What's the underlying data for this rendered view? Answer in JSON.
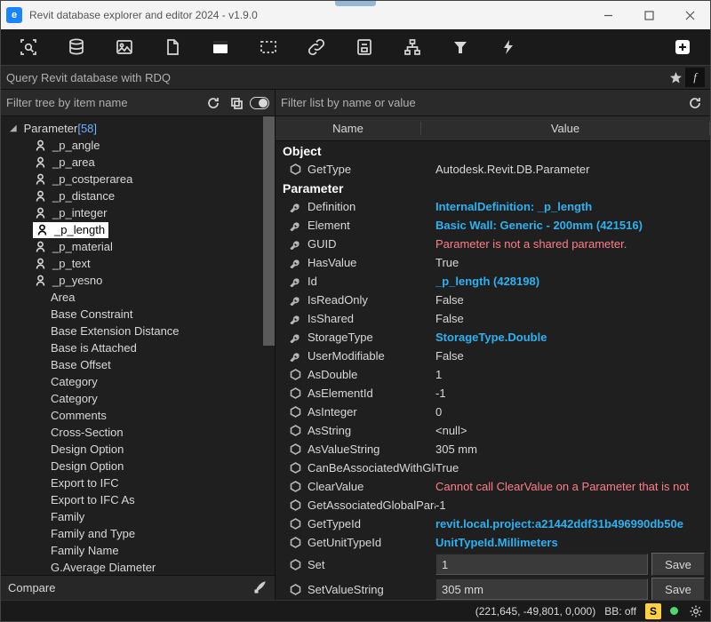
{
  "window": {
    "title": "Revit database explorer and editor 2024 - v1.9.0"
  },
  "search": {
    "placeholder": "Query Revit database with RDQ",
    "fx_label": "f"
  },
  "left_filter": {
    "placeholder": "Filter tree by item name"
  },
  "right_filter": {
    "placeholder": "Filter list by name or value"
  },
  "tree": {
    "root_label": "Parameter",
    "root_count": "[58]",
    "items": [
      {
        "label": "_p_angle"
      },
      {
        "label": "_p_area"
      },
      {
        "label": "_p_costperarea"
      },
      {
        "label": "_p_distance"
      },
      {
        "label": "_p_integer"
      },
      {
        "label": "_p_length",
        "selected": true
      },
      {
        "label": "_p_material"
      },
      {
        "label": "_p_text"
      },
      {
        "label": "_p_yesno"
      }
    ],
    "sub": [
      "Area",
      "Base Constraint",
      "Base Extension Distance",
      "Base is Attached",
      "Base Offset",
      "Category",
      "Category",
      "Comments",
      "Cross-Section",
      "Design Option",
      "Design Option",
      "Export to IFC",
      "Export to IFC As",
      "Family",
      "Family and Type",
      "Family Name",
      "G.Average Diameter"
    ]
  },
  "columns": {
    "name": "Name",
    "value": "Value"
  },
  "sections": [
    {
      "title": "Object",
      "rows": [
        {
          "icon": "hex",
          "name": "GetType",
          "value": "Autodesk.Revit.DB.Parameter"
        }
      ]
    },
    {
      "title": "Parameter",
      "rows": [
        {
          "icon": "wrench",
          "name": "Definition",
          "value": "InternalDefinition: _p_length",
          "cls": "link"
        },
        {
          "icon": "wrench",
          "name": "Element",
          "value": "Basic Wall: Generic - 200mm (421516)",
          "cls": "link"
        },
        {
          "icon": "wrench",
          "name": "GUID",
          "value": "Parameter is not a shared parameter.",
          "cls": "warn"
        },
        {
          "icon": "wrench",
          "name": "HasValue",
          "value": "True"
        },
        {
          "icon": "wrench",
          "name": "Id",
          "value": "_p_length (428198)",
          "cls": "link"
        },
        {
          "icon": "wrench",
          "name": "IsReadOnly",
          "value": "False"
        },
        {
          "icon": "wrench",
          "name": "IsShared",
          "value": "False"
        },
        {
          "icon": "wrench",
          "name": "StorageType",
          "value": "StorageType.Double",
          "cls": "link"
        },
        {
          "icon": "wrench",
          "name": "UserModifiable",
          "value": "False"
        },
        {
          "icon": "hex",
          "name": "AsDouble",
          "value": "1"
        },
        {
          "icon": "hex",
          "name": "AsElementId",
          "value": "-1"
        },
        {
          "icon": "hex",
          "name": "AsInteger",
          "value": "0"
        },
        {
          "icon": "hex",
          "name": "AsString",
          "value": "<null>"
        },
        {
          "icon": "hex",
          "name": "AsValueString",
          "value": "305 mm"
        },
        {
          "icon": "hex",
          "name": "CanBeAssociatedWithGlob",
          "value": "True"
        },
        {
          "icon": "hex",
          "name": "ClearValue",
          "value": "Cannot call ClearValue on a Parameter that is not",
          "cls": "warn"
        },
        {
          "icon": "hex",
          "name": "GetAssociatedGlobalParam",
          "value": "-1"
        },
        {
          "icon": "hex",
          "name": "GetTypeId",
          "value": "revit.local.project:a21442ddf31b496990db50e",
          "cls": "link"
        },
        {
          "icon": "hex",
          "name": "GetUnitTypeId",
          "value": "UnitTypeId.Millimeters",
          "cls": "link"
        }
      ],
      "edits": [
        {
          "name": "Set",
          "value": "1",
          "button": "Save"
        },
        {
          "name": "SetValueString",
          "value": "305 mm",
          "button": "Save"
        }
      ]
    }
  ],
  "compare": {
    "label": "Compare"
  },
  "status": {
    "coords": "(221,645, -49,801, 0,000)",
    "bb": "BB: off",
    "s": "S"
  }
}
